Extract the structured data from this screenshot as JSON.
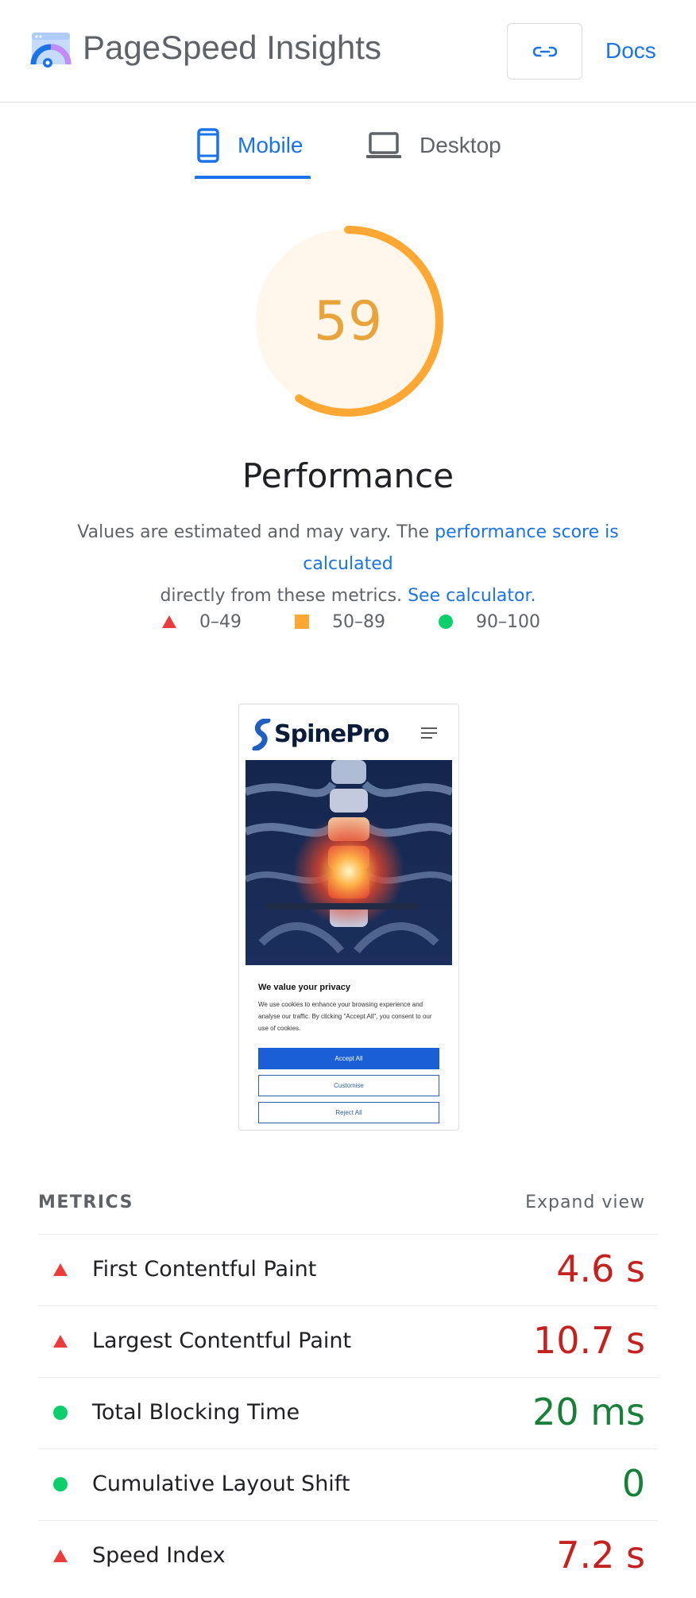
{
  "header": {
    "app_title": "PageSpeed Insights",
    "docs_label": "Docs",
    "link_icon": "link-icon"
  },
  "tabs": [
    {
      "label": "Mobile",
      "icon": "phone-icon",
      "selected": true
    },
    {
      "label": "Desktop",
      "icon": "laptop-icon",
      "selected": false
    }
  ],
  "performance": {
    "score": "59",
    "score_fraction": 0.59,
    "category": "Performance",
    "desc_prefix": "Values are estimated and may vary. The ",
    "desc_link": "performance score is calculated",
    "desc_middle": " directly from these metrics. ",
    "desc_link2": "See calculator."
  },
  "legend": [
    {
      "label": "0–49",
      "shape": "triangle",
      "color": "#eb3b3b"
    },
    {
      "label": "50–89",
      "shape": "square",
      "color": "#ffa733"
    },
    {
      "label": "90–100",
      "shape": "circle",
      "color": "#0cce6b"
    }
  ],
  "screenshot": {
    "brand": "SpinePro",
    "banner_title": "We value your privacy",
    "banner_text": "We use cookies to enhance your browsing experience and analyse our traffic. By clicking \"Accept All\", you consent to our use of cookies.",
    "accept": "Accept All",
    "customise": "Customise",
    "reject": "Reject All"
  },
  "metrics": {
    "heading": "METRICS",
    "expand": "Expand view",
    "items": [
      {
        "name": "First Contentful Paint",
        "value": "4.6 s",
        "rating": "poor"
      },
      {
        "name": "Largest Contentful Paint",
        "value": "10.7 s",
        "rating": "poor"
      },
      {
        "name": "Total Blocking Time",
        "value": "20 ms",
        "rating": "good"
      },
      {
        "name": "Cumulative Layout Shift",
        "value": "0",
        "rating": "good"
      },
      {
        "name": "Speed Index",
        "value": "7.2 s",
        "rating": "poor"
      }
    ]
  },
  "colors": {
    "accent": "#1a73e8",
    "gauge_average": "#ffa733",
    "gauge_bg": "#fff7eb",
    "poor": "#c5221f",
    "good": "#188038"
  }
}
